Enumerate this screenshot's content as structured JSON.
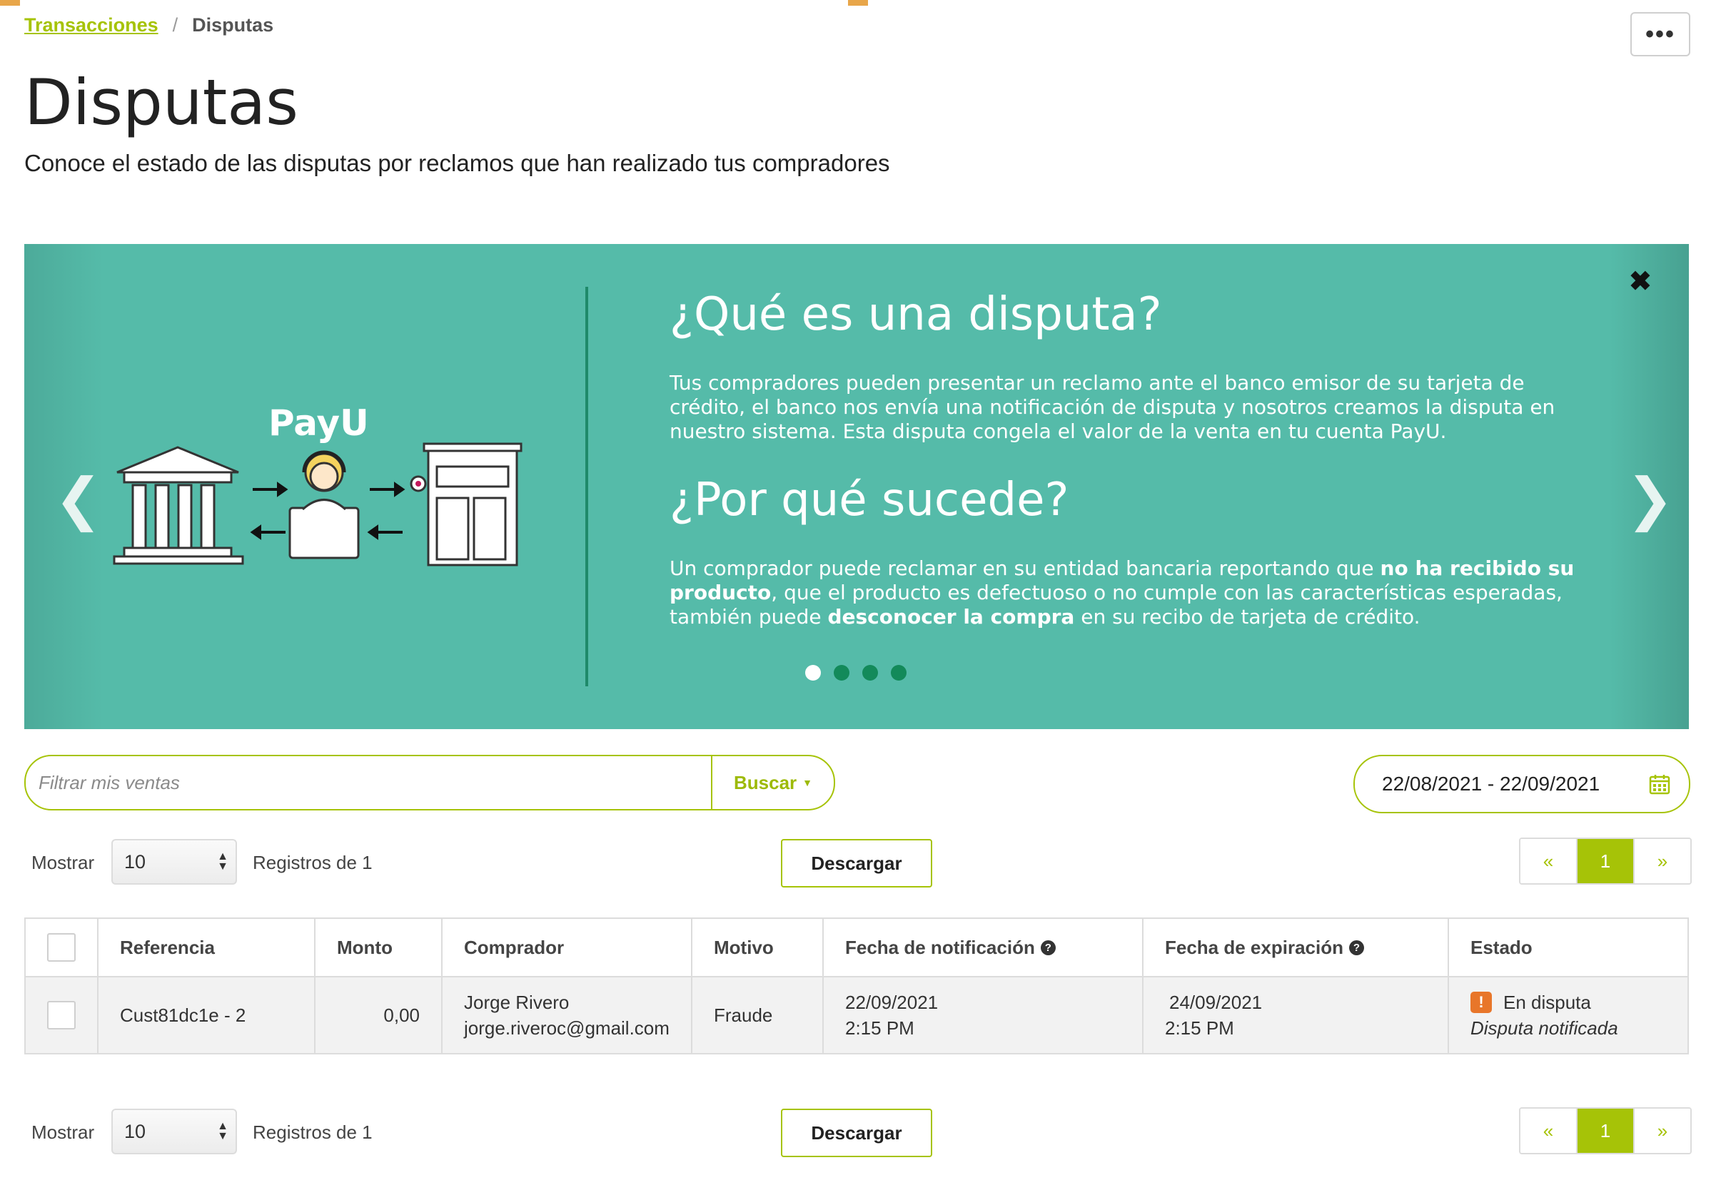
{
  "breadcrumb": {
    "parent": "Transacciones",
    "separator": "/",
    "current": "Disputas"
  },
  "header": {
    "more_label": "•••",
    "title": "Disputas",
    "subtitle": "Conoce el estado de las disputas por reclamos que han realizado tus compradores"
  },
  "banner": {
    "logo_text": "PayU",
    "close": "✖",
    "prev": "❮",
    "next": "❯",
    "heading1": "¿Qué es una disputa?",
    "text1": "Tus compradores pueden presentar un reclamo ante el banco emisor de su tarjeta de crédito, el banco nos envía una notificación de disputa y nosotros creamos la disputa en nuestro sistema. Esta disputa congela el valor de la venta en tu cuenta PayU.",
    "heading2": "¿Por qué sucede?",
    "text2_a": "Un comprador puede reclamar en su entidad bancaria reportando que ",
    "text2_b": "no ha recibido su producto",
    "text2_c": ", que el producto es defectuoso o no cumple con las características esperadas, también puede ",
    "text2_d": "desconocer la compra",
    "text2_e": " en su recibo de tarjeta de crédito.",
    "dots_count": 4,
    "active_dot": 0
  },
  "filter": {
    "placeholder": "Filtrar mis ventas",
    "search_label": "Buscar",
    "date_range": "22/08/2021 - 22/09/2021"
  },
  "controls": {
    "show_label": "Mostrar",
    "page_size": "10",
    "records_label": "Registros de 1",
    "download_label": "Descargar",
    "pager_prev": "«",
    "pager_current": "1",
    "pager_next": "»"
  },
  "table": {
    "columns": [
      "Referencia",
      "Monto",
      "Comprador",
      "Motivo",
      "Fecha de notificación",
      "Fecha de expiración",
      "Estado"
    ],
    "rows": [
      {
        "referencia": "Cust81dc1e - 2",
        "monto": "0,00",
        "comprador_nombre": "Jorge Rivero",
        "comprador_email": "jorge.riveroc@gmail.com",
        "motivo": "Fraude",
        "fecha_notificacion": "22/09/2021",
        "hora_notificacion": "2:15 PM",
        "fecha_expiracion": "24/09/2021",
        "hora_expiracion": "2:15 PM",
        "estado": "En disputa",
        "estado_detalle": "Disputa notificada"
      }
    ]
  },
  "colors": {
    "accent": "#a6c307",
    "banner": "#55bba9",
    "warning": "#e8762a"
  }
}
